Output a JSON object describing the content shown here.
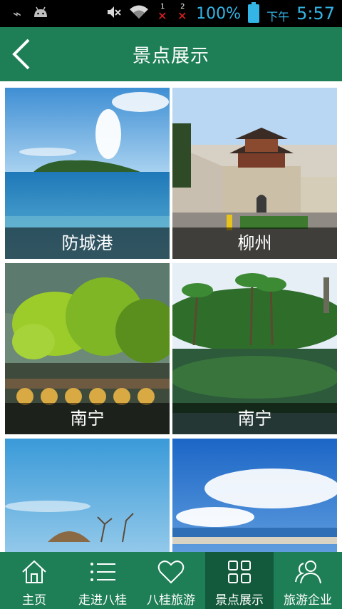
{
  "status_bar": {
    "battery": "100%",
    "ampm": "下午",
    "time": "5:57",
    "sim1": "1",
    "sim2": "2"
  },
  "header": {
    "title": "景点展示",
    "back_icon": "chevron-left-icon"
  },
  "tiles": [
    {
      "caption": "防城港"
    },
    {
      "caption": "柳州"
    },
    {
      "caption": "南宁"
    },
    {
      "caption": "南宁"
    },
    {
      "caption": ""
    },
    {
      "caption": ""
    }
  ],
  "bottom_nav": [
    {
      "label": "主页",
      "icon": "home-icon"
    },
    {
      "label": "走进八桂",
      "icon": "list-icon"
    },
    {
      "label": "八桂旅游",
      "icon": "heart-icon"
    },
    {
      "label": "景点展示",
      "icon": "grid-icon",
      "active": true
    },
    {
      "label": "旅游企业",
      "icon": "users-icon"
    }
  ],
  "colors": {
    "brand": "#1e7f56",
    "brand_dark": "#125a3b",
    "status_text": "#33b5e5"
  }
}
